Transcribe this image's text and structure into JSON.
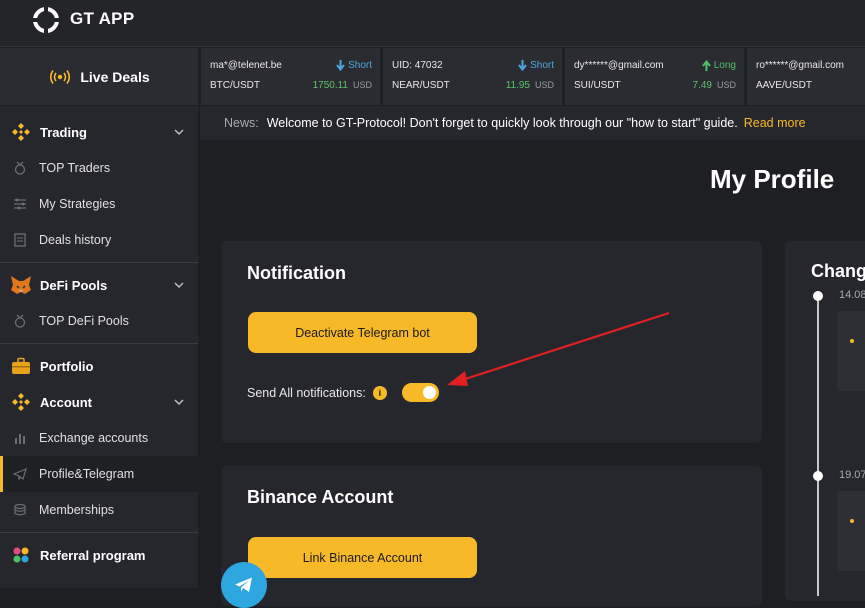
{
  "app": {
    "title": "GT APP"
  },
  "live_deals": {
    "label": "Live Deals",
    "deals": [
      {
        "user": "ma*@telenet.be",
        "direction": "Short",
        "pair": "BTC/USDT",
        "price": "1750.11",
        "currency": "USD"
      },
      {
        "user": "UID: 47032",
        "direction": "Short",
        "pair": "NEAR/USDT",
        "price": "11.95",
        "currency": "USD"
      },
      {
        "user": "dy******@gmail.com",
        "direction": "Long",
        "pair": "SUI/USDT",
        "price": "7.49",
        "currency": "USD"
      },
      {
        "user": "ro******@gmail.com",
        "direction": "",
        "pair": "AAVE/USDT",
        "price": "",
        "currency": ""
      }
    ]
  },
  "news": {
    "label": "News:",
    "text": "Welcome to GT-Protocol! Don't forget to quickly look through our \"how to start\" guide.",
    "link": "Read more"
  },
  "sidebar": {
    "trading": {
      "label": "Trading",
      "items": [
        "TOP Traders",
        "My Strategies",
        "Deals history"
      ]
    },
    "defi": {
      "label": "DeFi Pools",
      "items": [
        "TOP DeFi Pools"
      ]
    },
    "portfolio": {
      "label": "Portfolio"
    },
    "account": {
      "label": "Account",
      "items": [
        "Exchange accounts",
        "Profile&Telegram",
        "Memberships"
      ]
    },
    "referral": {
      "label": "Referral program"
    }
  },
  "main": {
    "title": "My Profile",
    "notification": {
      "title": "Notification",
      "button": "Deactivate Telegram bot",
      "toggle_label": "Send All notifications:",
      "toggle_on": true
    },
    "binance": {
      "title": "Binance Account",
      "button": "Link Binance Account"
    },
    "changes": {
      "title": "Chang",
      "dates": [
        "14.08",
        "19.07"
      ]
    }
  },
  "colors": {
    "accent": "#f7b928",
    "background": "#1e1f23",
    "panel": "#26272c",
    "short": "#4aa8e0",
    "long": "#4cc066",
    "price": "#5bc46a",
    "annotation_arrow": "#e02020"
  }
}
